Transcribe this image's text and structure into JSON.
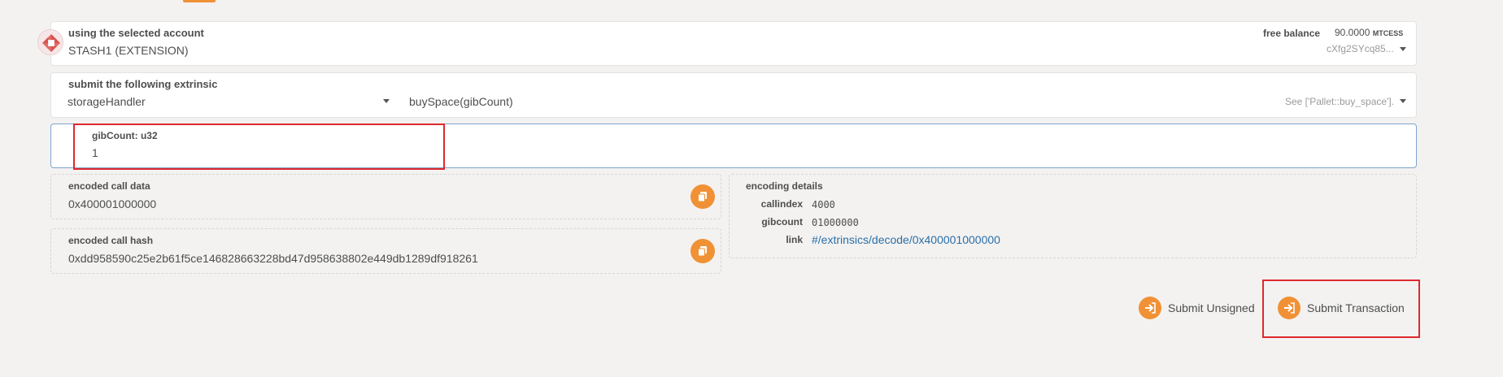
{
  "account": {
    "label": "using the selected account",
    "name": "STASH1 (EXTENSION)",
    "balance_label": "free balance",
    "balance_value": "90.0000",
    "balance_unit": "MTCESS",
    "address": "cXfg2SYcq85..."
  },
  "extrinsic": {
    "label": "submit the following extrinsic",
    "pallet": "storageHandler",
    "method": "buySpace(gibCount)",
    "doc_hint": "See ['Pallet::buy_space']."
  },
  "param": {
    "label": "gibCount: u32",
    "value": "1"
  },
  "encoded_call_data": {
    "label": "encoded call data",
    "value": "0x400001000000"
  },
  "encoded_call_hash": {
    "label": "encoded call hash",
    "value": "0xdd958590c25e2b61f5ce146828663228bd47d958638802e449db1289df918261"
  },
  "encoding_details": {
    "label": "encoding details",
    "rows": [
      {
        "key": "callindex",
        "value": "4000"
      },
      {
        "key": "gibcount",
        "value": "01000000"
      },
      {
        "key": "link",
        "value": "#/extrinsics/decode/0x400001000000"
      }
    ]
  },
  "actions": {
    "submit_unsigned": "Submit Unsigned",
    "submit_transaction": "Submit Transaction"
  },
  "colors": {
    "accent": "#f19135",
    "highlight": "#e0282e",
    "link": "#2a6fa8"
  }
}
